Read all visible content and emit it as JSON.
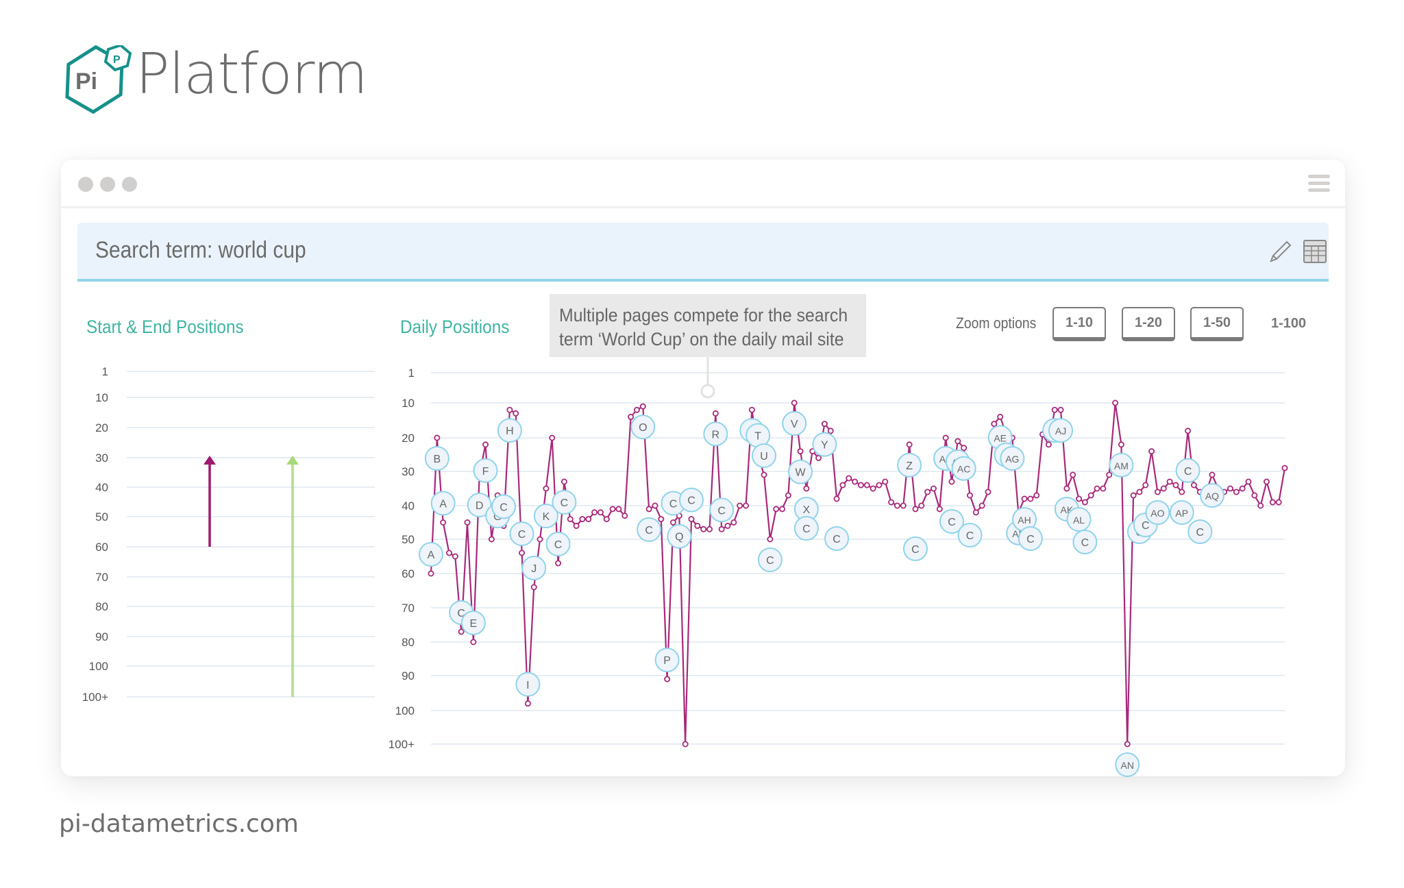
{
  "brand": {
    "logo_big_letters": "Pi",
    "logo_small_letter": "P",
    "name": "Platform",
    "accent": "#16918a"
  },
  "window": {
    "menu_icon": "hamburger-icon"
  },
  "search": {
    "label": "Search term: world cup",
    "edit_icon": "pencil-icon",
    "table_icon": "table-icon"
  },
  "sections": {
    "start_end_title": "Start & End Positions",
    "daily_title": "Daily Positions"
  },
  "annotation": {
    "line1": "Multiple pages compete for the search",
    "line2": "term ‘World Cup’ on the daily mail site"
  },
  "zoom": {
    "label": "Zoom options",
    "options": [
      "1-10",
      "1-20",
      "1-50",
      "1-100"
    ],
    "active": "1-100"
  },
  "footer": {
    "url": "pi-datametrics.com"
  },
  "chart_data": [
    {
      "type": "arrow-range",
      "title": "Start & End Positions",
      "y_ticks": [
        "1",
        "10",
        "20",
        "30",
        "40",
        "50",
        "60",
        "70",
        "80",
        "90",
        "100",
        "100+"
      ],
      "y_inverted": true,
      "grid": true,
      "series": [
        {
          "name": "page-arrow-1",
          "color": "#a0196e",
          "start": 60,
          "end": 30
        },
        {
          "name": "page-arrow-2",
          "color": "#a9d97a",
          "start": 101,
          "end": 30
        }
      ]
    },
    {
      "type": "line",
      "title": "Daily Positions",
      "y_ticks": [
        "1",
        "10",
        "20",
        "30",
        "40",
        "50",
        "60",
        "70",
        "80",
        "90",
        "100",
        "100+"
      ],
      "y_inverted": true,
      "ylim": [
        1,
        101
      ],
      "grid": true,
      "line_color": "#a8287a",
      "label_fill": "#eef4f9",
      "label_stroke": "#8fd3ec",
      "values": [
        60,
        20,
        45,
        54,
        55,
        77,
        45,
        80,
        31,
        22,
        50,
        37,
        46,
        12,
        13,
        54,
        98,
        64,
        50,
        35,
        20,
        57,
        33,
        44,
        46,
        44,
        44,
        42,
        42,
        44,
        41,
        41,
        43,
        14,
        12,
        11,
        41,
        40,
        44,
        91,
        45,
        43,
        101,
        44,
        46,
        47,
        47,
        13,
        47,
        46,
        45,
        40,
        40,
        12,
        25,
        31,
        50,
        41,
        41,
        37,
        10,
        24,
        35,
        24,
        26,
        16,
        18,
        38,
        34,
        32,
        33,
        34,
        34,
        35,
        34,
        33,
        39,
        40,
        40,
        22,
        41,
        40,
        36,
        35,
        41,
        20,
        33,
        21,
        23,
        37,
        42,
        40,
        36,
        16,
        14,
        19,
        20,
        42,
        38,
        38,
        37,
        19,
        22,
        12,
        12,
        35,
        31,
        38,
        39,
        37,
        35,
        35,
        31,
        10,
        22,
        101,
        37,
        36,
        34,
        24,
        36,
        35,
        33,
        34,
        36,
        18,
        34,
        36,
        36,
        31,
        35,
        36,
        35,
        36,
        35,
        33,
        37,
        40,
        33,
        39,
        39,
        29
      ],
      "labels": [
        {
          "text": "A",
          "i": 0,
          "dy": "up"
        },
        {
          "text": "B",
          "i": 1,
          "dy": "down"
        },
        {
          "text": "A",
          "i": 2,
          "dy": "up"
        },
        {
          "text": "C",
          "i": 5,
          "dy": "up"
        },
        {
          "text": "E",
          "i": 7,
          "dy": "up"
        },
        {
          "text": "D",
          "i": 8,
          "dy": "down2"
        },
        {
          "text": "F",
          "i": 9,
          "dy": "down3"
        },
        {
          "text": "G",
          "i": 11,
          "dy": "down"
        },
        {
          "text": "C",
          "i": 12,
          "dy": "up"
        },
        {
          "text": "H",
          "i": 13,
          "dy": "down"
        },
        {
          "text": "C",
          "i": 15,
          "dy": "up"
        },
        {
          "text": "I",
          "i": 16,
          "dy": "up"
        },
        {
          "text": "J",
          "i": 17,
          "dy": "up"
        },
        {
          "text": "K",
          "i": 19,
          "dy": "down4"
        },
        {
          "text": "C",
          "i": 21,
          "dy": "up"
        },
        {
          "text": "C",
          "i": 22,
          "dy": "down"
        },
        {
          "text": "O",
          "i": 35,
          "dy": "down"
        },
        {
          "text": "C",
          "i": 36,
          "dy": "down"
        },
        {
          "text": "P",
          "i": 39,
          "dy": "up"
        },
        {
          "text": "C",
          "i": 40,
          "dy": "up"
        },
        {
          "text": "Q",
          "i": 41,
          "dy": "down"
        },
        {
          "text": "C",
          "i": 43,
          "dy": "up"
        },
        {
          "text": "R",
          "i": 47,
          "dy": "down"
        },
        {
          "text": "C",
          "i": 48,
          "dy": "up"
        },
        {
          "text": "S",
          "i": 53,
          "dy": "down"
        },
        {
          "text": "T",
          "i": 54,
          "dy": "up"
        },
        {
          "text": "U",
          "i": 55,
          "dy": "up"
        },
        {
          "text": "C",
          "i": 56,
          "dy": "down"
        },
        {
          "text": "V",
          "i": 60,
          "dy": "down"
        },
        {
          "text": "W",
          "i": 61,
          "dy": "down"
        },
        {
          "text": "X",
          "i": 62,
          "dy": "down"
        },
        {
          "text": "Y",
          "i": 65,
          "dy": "down"
        },
        {
          "text": "C",
          "i": 62,
          "dy": "low"
        },
        {
          "text": "C",
          "i": 67,
          "dy": "low"
        },
        {
          "text": "Z",
          "i": 79,
          "dy": "down"
        },
        {
          "text": "C",
          "i": 80,
          "dy": "low"
        },
        {
          "text": "AA",
          "i": 85,
          "dy": "down"
        },
        {
          "text": "AB",
          "i": 87,
          "dy": "down"
        },
        {
          "text": "AC",
          "i": 88,
          "dy": "down"
        },
        {
          "text": "C",
          "i": 86,
          "dy": "low"
        },
        {
          "text": "C",
          "i": 89,
          "dy": "low"
        },
        {
          "text": "AE",
          "i": 94,
          "dy": "down"
        },
        {
          "text": "AF",
          "i": 95,
          "dy": "down"
        },
        {
          "text": "AG",
          "i": 96,
          "dy": "down"
        },
        {
          "text": "AF",
          "i": 97,
          "dy": "down"
        },
        {
          "text": "AH",
          "i": 98,
          "dy": "down"
        },
        {
          "text": "C",
          "i": 99,
          "dy": "low"
        },
        {
          "text": "AI",
          "i": 103,
          "dy": "down"
        },
        {
          "text": "AJ",
          "i": 104,
          "dy": "down"
        },
        {
          "text": "AK",
          "i": 105,
          "dy": "down"
        },
        {
          "text": "AL",
          "i": 107,
          "dy": "down"
        },
        {
          "text": "C",
          "i": 108,
          "dy": "low"
        },
        {
          "text": "AM",
          "i": 114,
          "dy": "down"
        },
        {
          "text": "AN",
          "i": 115,
          "dy": "down"
        },
        {
          "text": "C",
          "i": 117,
          "dy": "low"
        },
        {
          "text": "C",
          "i": 118,
          "dy": "low"
        },
        {
          "text": "AO",
          "i": 120,
          "dy": "down"
        },
        {
          "text": "AP",
          "i": 124,
          "dy": "down"
        },
        {
          "text": "C",
          "i": 125,
          "dy": "low"
        },
        {
          "text": "C",
          "i": 127,
          "dy": "low"
        },
        {
          "text": "AQ",
          "i": 129,
          "dy": "down"
        }
      ],
      "annotation_marker_x_index": 40
    }
  ]
}
